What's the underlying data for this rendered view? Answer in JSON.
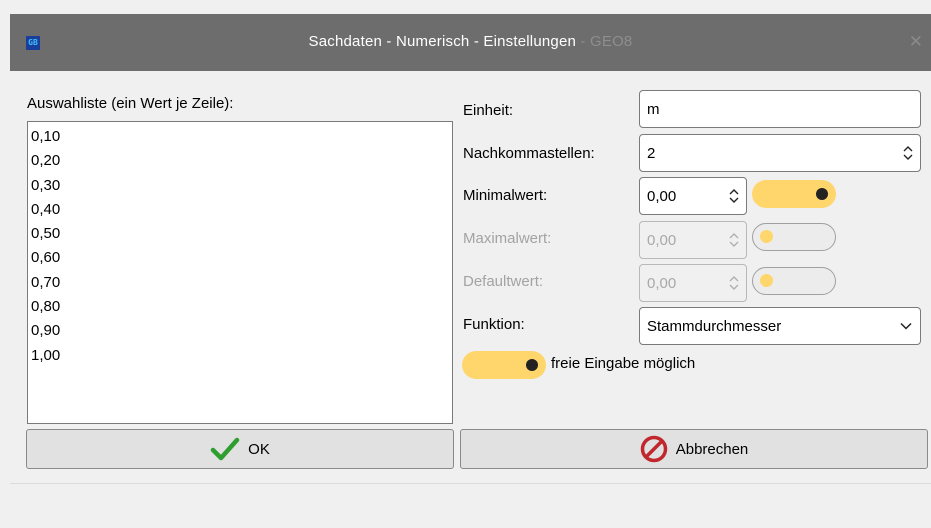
{
  "window": {
    "app_icon_text": "GB",
    "title": "Sachdaten - Numerisch - Einstellungen",
    "title_suffix": " - GEO8",
    "close_icon": "close-icon"
  },
  "list": {
    "label": "Auswahliste (ein Wert je Zeile):",
    "items": [
      "0,10",
      "0,20",
      "0,30",
      "0,40",
      "0,50",
      "0,60",
      "0,70",
      "0,80",
      "0,90",
      "1,00"
    ]
  },
  "form": {
    "einheit": {
      "label": "Einheit:",
      "value": "m"
    },
    "nachkomma": {
      "label": "Nachkommastellen:",
      "value": "2"
    },
    "minimal": {
      "label": "Minimalwert:",
      "value": "0,00",
      "enabled": true
    },
    "maximal": {
      "label": "Maximalwert:",
      "value": "0,00",
      "enabled": false
    },
    "default": {
      "label": "Defaultwert:",
      "value": "0,00",
      "enabled": false
    },
    "funktion": {
      "label": "Funktion:",
      "value": "Stammdurchmesser"
    },
    "free_input": {
      "label": "freie Eingabe möglich",
      "enabled": true
    }
  },
  "buttons": {
    "ok": {
      "label": "OK",
      "icon": "checkmark-icon"
    },
    "cancel": {
      "label": "Abbrechen",
      "icon": "prohibited-icon"
    }
  },
  "colors": {
    "titlebar": "#6d6d6d",
    "toggle_on": "#ffd66b",
    "check_green": "#2e9e2e",
    "cancel_red": "#c0282d"
  }
}
